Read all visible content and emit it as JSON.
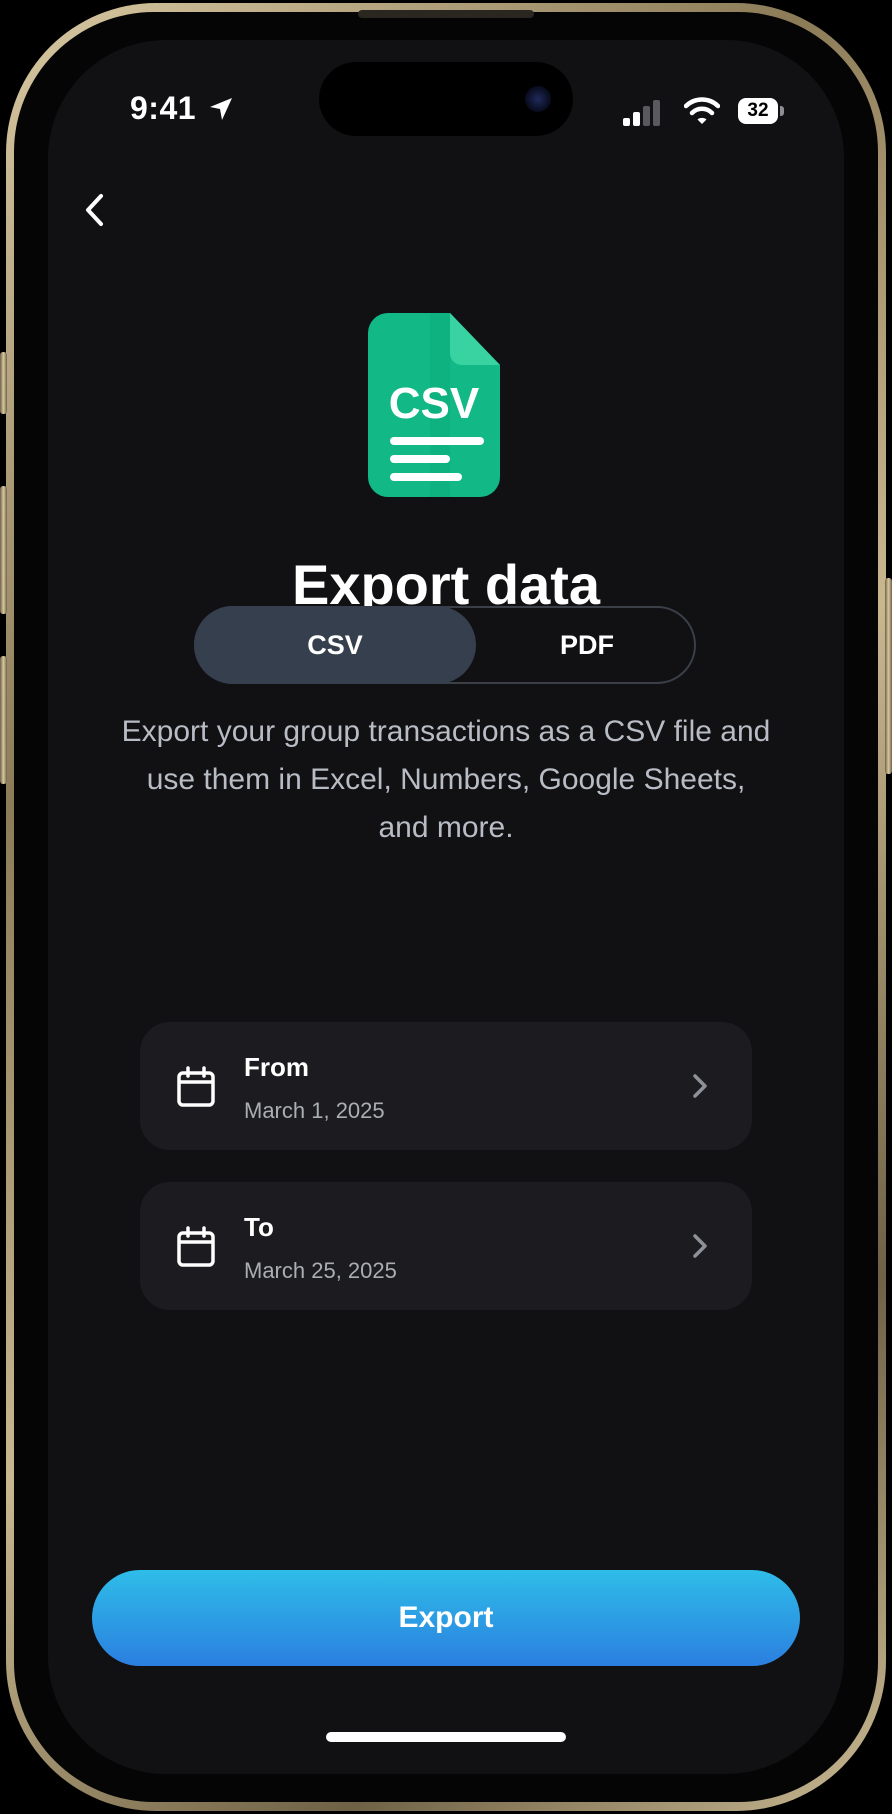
{
  "status_bar": {
    "time": "9:41",
    "battery": "32"
  },
  "file_icon": {
    "label": "CSV",
    "color": "#12b886"
  },
  "page": {
    "title": "Export data"
  },
  "format_toggle": {
    "options": [
      "CSV",
      "PDF"
    ],
    "selected": "CSV"
  },
  "description": "Export your group transactions as a CSV file and use them in Excel, Numbers, Google Sheets, and more.",
  "date_range": {
    "from": {
      "label": "From",
      "value": "March 1, 2025"
    },
    "to": {
      "label": "To",
      "value": "March 25, 2025"
    }
  },
  "export_button": {
    "label": "Export"
  },
  "colors": {
    "background": "#111114",
    "card": "#1c1c20",
    "segment_active": "#353f4e",
    "accent_top": "#2ebde8",
    "accent_bottom": "#2b7fe0"
  }
}
